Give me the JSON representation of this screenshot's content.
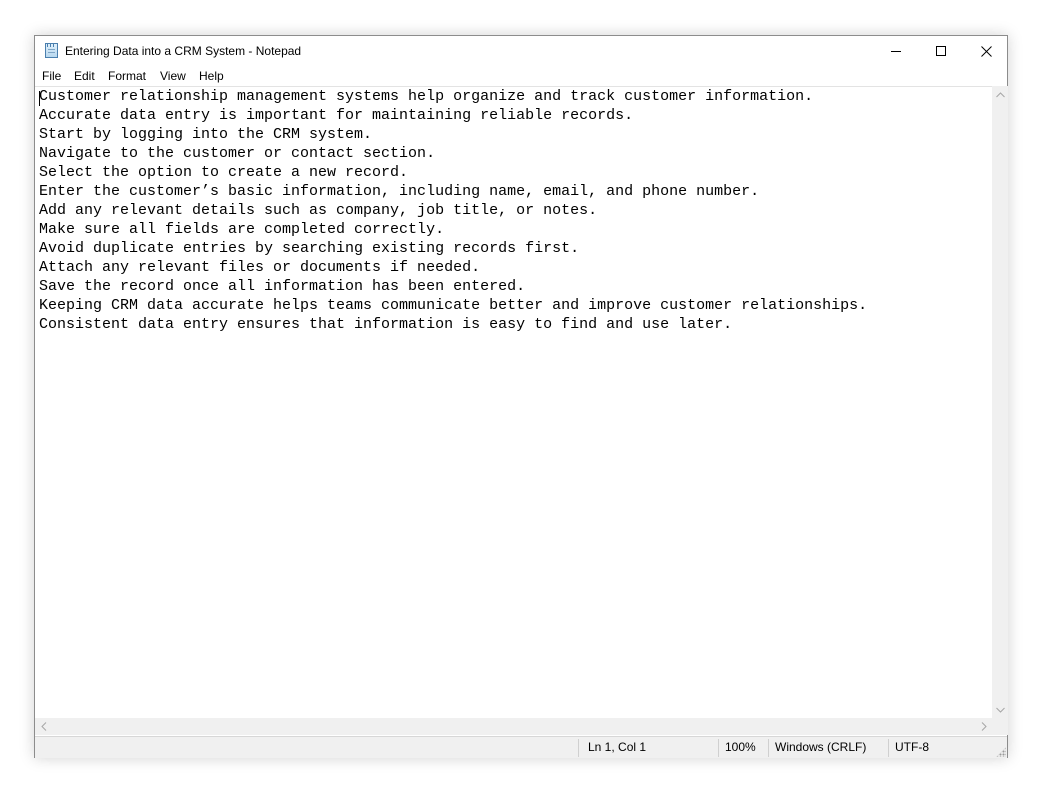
{
  "window": {
    "title": "Entering Data into a CRM System - Notepad",
    "icon": "notepad-icon"
  },
  "controls": {
    "minimize_icon": "minimize-icon",
    "maximize_icon": "maximize-icon",
    "close_icon": "close-icon"
  },
  "menu": {
    "items": [
      "File",
      "Edit",
      "Format",
      "View",
      "Help"
    ]
  },
  "editor": {
    "lines": [
      "Customer relationship management systems help organize and track customer information.",
      "Accurate data entry is important for maintaining reliable records.",
      "Start by logging into the CRM system.",
      "Navigate to the customer or contact section.",
      "Select the option to create a new record.",
      "Enter the customer’s basic information, including name, email, and phone number.",
      "Add any relevant details such as company, job title, or notes.",
      "Make sure all fields are completed correctly.",
      "Avoid duplicate entries by searching existing records first.",
      "Attach any relevant files or documents if needed.",
      "Save the record once all information has been entered.",
      "Keeping CRM data accurate helps teams communicate better and improve customer relationships.",
      "Consistent data entry ensures that information is easy to find and use later."
    ]
  },
  "status": {
    "position": "Ln 1, Col 1",
    "zoom": "100%",
    "line_ending": "Windows (CRLF)",
    "encoding": "UTF-8"
  },
  "colors": {
    "chrome_background": "#f0f0f0",
    "editor_background": "#ffffff",
    "text": "#000000"
  }
}
